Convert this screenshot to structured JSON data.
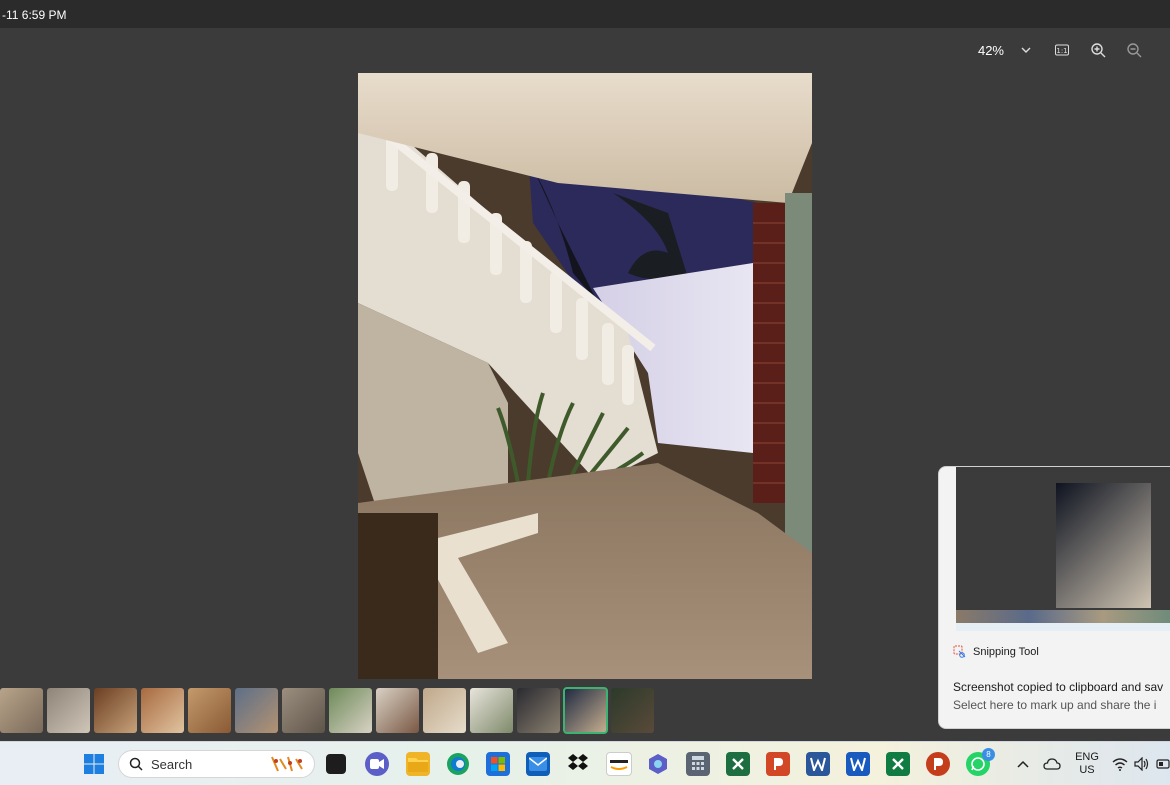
{
  "window": {
    "title": "-11 6:59 PM"
  },
  "toolbar": {
    "zoom": "42%",
    "zoom_dropdown_icon": "chevron-down-icon",
    "actual_size_icon": "one-to-one-icon",
    "zoom_in_icon": "zoom-in-icon",
    "zoom_out_icon": "zoom-out-icon"
  },
  "filmstrip": {
    "thumb_count": 14,
    "active_index": 12
  },
  "notification": {
    "app_name": "Snipping Tool",
    "message": "Screenshot copied to clipboard and sav",
    "subtext": "Select here to mark up and share the i"
  },
  "taskbar": {
    "search_placeholder": "Search",
    "language_line1": "ENG",
    "language_line2": "US",
    "whatsapp_badge": "8"
  },
  "colors": {
    "background": "#3b3b3b",
    "titlebar": "#2b2b2b",
    "active_thumb_outline": "#3cb371"
  }
}
